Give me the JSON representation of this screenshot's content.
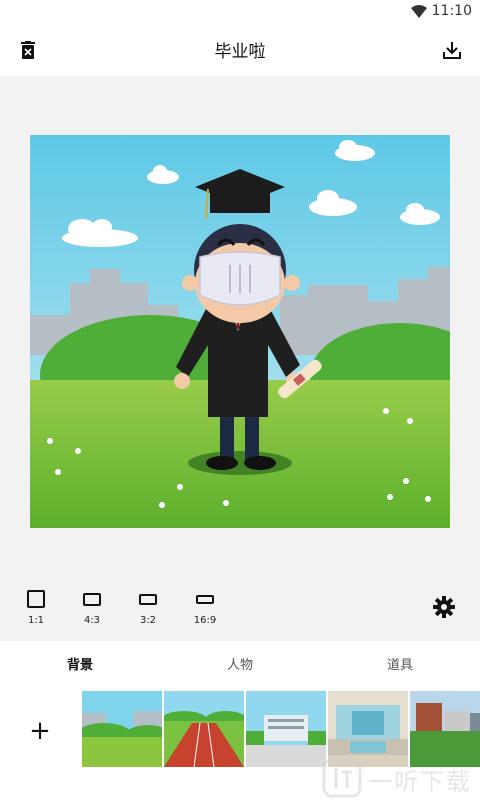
{
  "status_bar": {
    "time": "11:10"
  },
  "app_bar": {
    "title": "毕业啦"
  },
  "ratios": [
    {
      "label": "1:1"
    },
    {
      "label": "4:3"
    },
    {
      "label": "3:2"
    },
    {
      "label": "16:9"
    }
  ],
  "tabs": [
    {
      "label": "背景"
    },
    {
      "label": "人物"
    },
    {
      "label": "道具"
    }
  ],
  "add_label": "+",
  "watermark": "一听下载",
  "colors": {
    "sky": "#6ecfe8",
    "grass": "#7bc43a",
    "gown": "#1e1e1e"
  }
}
